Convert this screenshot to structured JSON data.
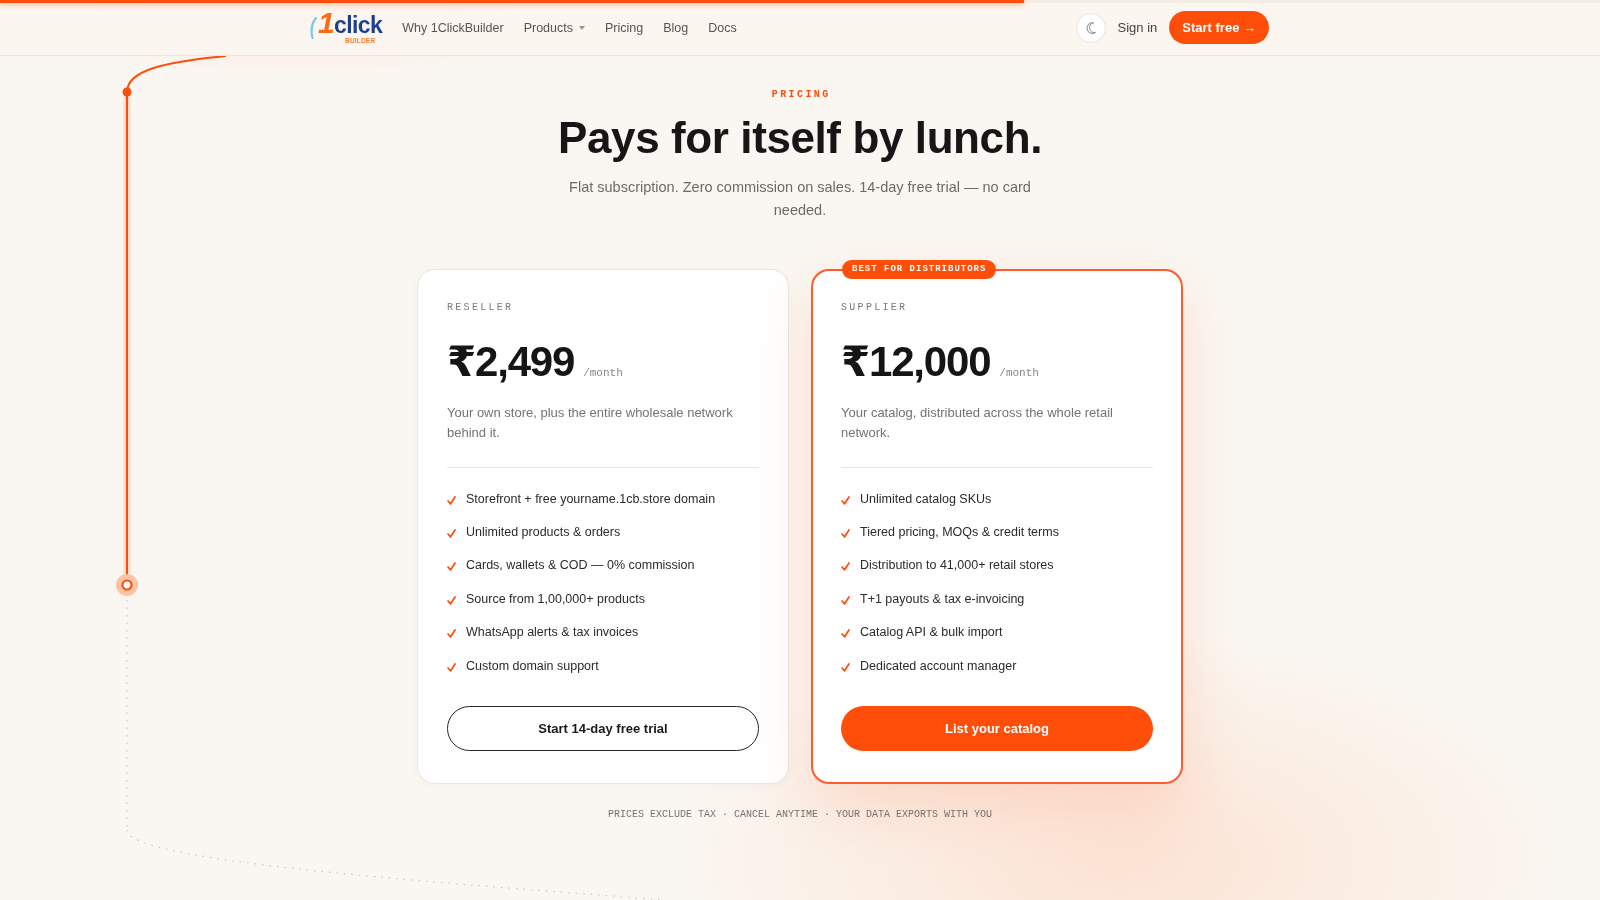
{
  "progress_bar": {
    "level": 0.64
  },
  "header": {
    "logo": {
      "wordmark": "1click",
      "tagline": "BUILDER"
    },
    "nav_links": [
      {
        "label": "Why 1ClickBuilder",
        "has_dropdown": false
      },
      {
        "label": "Products",
        "has_dropdown": true
      },
      {
        "label": "Pricing",
        "has_dropdown": false
      },
      {
        "label": "Blog",
        "has_dropdown": false
      },
      {
        "label": "Docs",
        "has_dropdown": false
      }
    ],
    "sign_in": "Sign in",
    "cta": "Start free →"
  },
  "pricing": {
    "eyebrow": "PRICING",
    "title": "Pays for itself by lunch.",
    "subtitle": "Flat subscription. Zero commission on sales. 14-day free trial — no card needed.",
    "plans": [
      {
        "name": "RESELLER",
        "price": "₹2,499",
        "period": "/month",
        "description": "Your own store, plus the entire wholesale network behind it.",
        "features": [
          "Storefront + free yourname.1cb.store domain",
          "Unlimited products & orders",
          "Cards, wallets & COD — 0% commission",
          "Source from 1,00,000+ products",
          "WhatsApp alerts & tax invoices",
          "Custom domain support"
        ],
        "cta": "Start 14-day free trial",
        "featured": false
      },
      {
        "badge": "BEST FOR DISTRIBUTORS",
        "name": "SUPPLIER",
        "price": "₹12,000",
        "period": "/month",
        "description": "Your catalog, distributed across the whole retail network.",
        "features": [
          "Unlimited catalog SKUs",
          "Tiered pricing, MOQs & credit terms",
          "Distribution to 41,000+ retail stores",
          "T+1 payouts & tax e-invoicing",
          "Catalog API & bulk import",
          "Dedicated account manager"
        ],
        "cta": "List your catalog",
        "featured": true
      }
    ],
    "footnote": "PRICES EXCLUDE TAX · CANCEL ANYTIME · YOUR DATA EXPORTS WITH YOU"
  }
}
